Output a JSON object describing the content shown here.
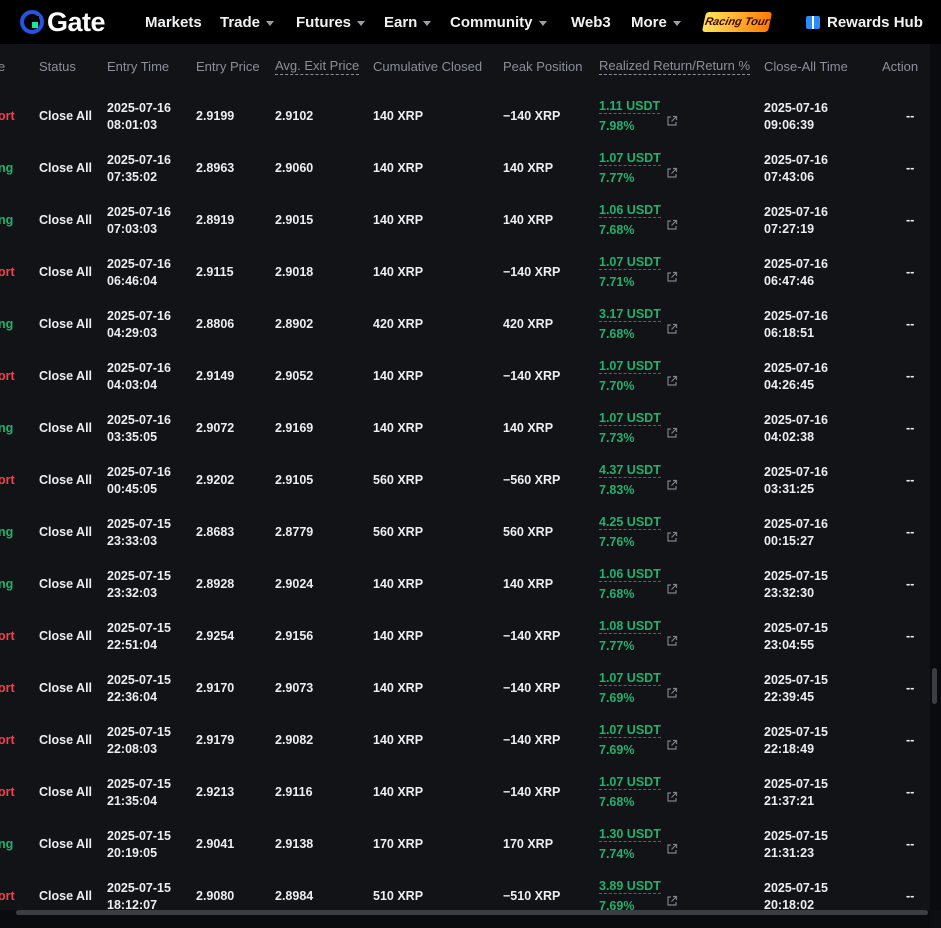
{
  "nav": {
    "logo": "Gate",
    "items": [
      {
        "label": "Markets",
        "caret": false
      },
      {
        "label": "Trade",
        "caret": true
      },
      {
        "label": "Futures",
        "caret": true
      },
      {
        "label": "Earn",
        "caret": true
      },
      {
        "label": "Community",
        "caret": true
      },
      {
        "label": "Web3",
        "caret": false
      },
      {
        "label": "More",
        "caret": true
      }
    ],
    "racing_badge": "Racing Tour",
    "rewards_hub": "Rewards Hub"
  },
  "table": {
    "headers": {
      "side": "e",
      "status": "Status",
      "entry_time": "Entry Time",
      "entry_price": "Entry Price",
      "avg_exit": "Avg. Exit Price",
      "cum_closed": "Cumulative Closed",
      "peak": "Peak Position",
      "realized": "Realized Return/Return %",
      "close_time": "Close-All Time",
      "action": "Action"
    },
    "rows": [
      {
        "side": "ort",
        "side_type": "short",
        "status": "Close All",
        "entry_date": "2025-07-16",
        "entry_clock": "08:01:03",
        "entry_price": "2.9199",
        "avg_exit": "2.9102",
        "cum": "140 XRP",
        "peak": "−140 XRP",
        "usdt": "1.11 USDT",
        "pct": "7.98%",
        "close_date": "2025-07-16",
        "close_clock": "09:06:39",
        "action": "--"
      },
      {
        "side": "ng",
        "side_type": "long",
        "status": "Close All",
        "entry_date": "2025-07-16",
        "entry_clock": "07:35:02",
        "entry_price": "2.8963",
        "avg_exit": "2.9060",
        "cum": "140 XRP",
        "peak": "140 XRP",
        "usdt": "1.07 USDT",
        "pct": "7.77%",
        "close_date": "2025-07-16",
        "close_clock": "07:43:06",
        "action": "--"
      },
      {
        "side": "ng",
        "side_type": "long",
        "status": "Close All",
        "entry_date": "2025-07-16",
        "entry_clock": "07:03:03",
        "entry_price": "2.8919",
        "avg_exit": "2.9015",
        "cum": "140 XRP",
        "peak": "140 XRP",
        "usdt": "1.06 USDT",
        "pct": "7.68%",
        "close_date": "2025-07-16",
        "close_clock": "07:27:19",
        "action": "--"
      },
      {
        "side": "ort",
        "side_type": "short",
        "status": "Close All",
        "entry_date": "2025-07-16",
        "entry_clock": "06:46:04",
        "entry_price": "2.9115",
        "avg_exit": "2.9018",
        "cum": "140 XRP",
        "peak": "−140 XRP",
        "usdt": "1.07 USDT",
        "pct": "7.71%",
        "close_date": "2025-07-16",
        "close_clock": "06:47:46",
        "action": "--"
      },
      {
        "side": "ng",
        "side_type": "long",
        "status": "Close All",
        "entry_date": "2025-07-16",
        "entry_clock": "04:29:03",
        "entry_price": "2.8806",
        "avg_exit": "2.8902",
        "cum": "420 XRP",
        "peak": "420 XRP",
        "usdt": "3.17 USDT",
        "pct": "7.68%",
        "close_date": "2025-07-16",
        "close_clock": "06:18:51",
        "action": "--"
      },
      {
        "side": "ort",
        "side_type": "short",
        "status": "Close All",
        "entry_date": "2025-07-16",
        "entry_clock": "04:03:04",
        "entry_price": "2.9149",
        "avg_exit": "2.9052",
        "cum": "140 XRP",
        "peak": "−140 XRP",
        "usdt": "1.07 USDT",
        "pct": "7.70%",
        "close_date": "2025-07-16",
        "close_clock": "04:26:45",
        "action": "--"
      },
      {
        "side": "ng",
        "side_type": "long",
        "status": "Close All",
        "entry_date": "2025-07-16",
        "entry_clock": "03:35:05",
        "entry_price": "2.9072",
        "avg_exit": "2.9169",
        "cum": "140 XRP",
        "peak": "140 XRP",
        "usdt": "1.07 USDT",
        "pct": "7.73%",
        "close_date": "2025-07-16",
        "close_clock": "04:02:38",
        "action": "--"
      },
      {
        "side": "ort",
        "side_type": "short",
        "status": "Close All",
        "entry_date": "2025-07-16",
        "entry_clock": "00:45:05",
        "entry_price": "2.9202",
        "avg_exit": "2.9105",
        "cum": "560 XRP",
        "peak": "−560 XRP",
        "usdt": "4.37 USDT",
        "pct": "7.83%",
        "close_date": "2025-07-16",
        "close_clock": "03:31:25",
        "action": "--"
      },
      {
        "side": "ng",
        "side_type": "long",
        "status": "Close All",
        "entry_date": "2025-07-15",
        "entry_clock": "23:33:03",
        "entry_price": "2.8683",
        "avg_exit": "2.8779",
        "cum": "560 XRP",
        "peak": "560 XRP",
        "usdt": "4.25 USDT",
        "pct": "7.76%",
        "close_date": "2025-07-16",
        "close_clock": "00:15:27",
        "action": "--"
      },
      {
        "side": "ng",
        "side_type": "long",
        "status": "Close All",
        "entry_date": "2025-07-15",
        "entry_clock": "23:32:03",
        "entry_price": "2.8928",
        "avg_exit": "2.9024",
        "cum": "140 XRP",
        "peak": "140 XRP",
        "usdt": "1.06 USDT",
        "pct": "7.68%",
        "close_date": "2025-07-15",
        "close_clock": "23:32:30",
        "action": "--"
      },
      {
        "side": "ort",
        "side_type": "short",
        "status": "Close All",
        "entry_date": "2025-07-15",
        "entry_clock": "22:51:04",
        "entry_price": "2.9254",
        "avg_exit": "2.9156",
        "cum": "140 XRP",
        "peak": "−140 XRP",
        "usdt": "1.08 USDT",
        "pct": "7.77%",
        "close_date": "2025-07-15",
        "close_clock": "23:04:55",
        "action": "--"
      },
      {
        "side": "ort",
        "side_type": "short",
        "status": "Close All",
        "entry_date": "2025-07-15",
        "entry_clock": "22:36:04",
        "entry_price": "2.9170",
        "avg_exit": "2.9073",
        "cum": "140 XRP",
        "peak": "−140 XRP",
        "usdt": "1.07 USDT",
        "pct": "7.69%",
        "close_date": "2025-07-15",
        "close_clock": "22:39:45",
        "action": "--"
      },
      {
        "side": "ort",
        "side_type": "short",
        "status": "Close All",
        "entry_date": "2025-07-15",
        "entry_clock": "22:08:03",
        "entry_price": "2.9179",
        "avg_exit": "2.9082",
        "cum": "140 XRP",
        "peak": "−140 XRP",
        "usdt": "1.07 USDT",
        "pct": "7.69%",
        "close_date": "2025-07-15",
        "close_clock": "22:18:49",
        "action": "--"
      },
      {
        "side": "ort",
        "side_type": "short",
        "status": "Close All",
        "entry_date": "2025-07-15",
        "entry_clock": "21:35:04",
        "entry_price": "2.9213",
        "avg_exit": "2.9116",
        "cum": "140 XRP",
        "peak": "−140 XRP",
        "usdt": "1.07 USDT",
        "pct": "7.68%",
        "close_date": "2025-07-15",
        "close_clock": "21:37:21",
        "action": "--"
      },
      {
        "side": "ng",
        "side_type": "long",
        "status": "Close All",
        "entry_date": "2025-07-15",
        "entry_clock": "20:19:05",
        "entry_price": "2.9041",
        "avg_exit": "2.9138",
        "cum": "170 XRP",
        "peak": "170 XRP",
        "usdt": "1.30 USDT",
        "pct": "7.74%",
        "close_date": "2025-07-15",
        "close_clock": "21:31:23",
        "action": "--"
      },
      {
        "side": "ort",
        "side_type": "short",
        "status": "Close All",
        "entry_date": "2025-07-15",
        "entry_clock": "18:12:07",
        "entry_price": "2.9080",
        "avg_exit": "2.8984",
        "cum": "510 XRP",
        "peak": "−510 XRP",
        "usdt": "3.89 USDT",
        "pct": "7.69%",
        "close_date": "2025-07-15",
        "close_clock": "20:18:02",
        "action": "--"
      }
    ]
  },
  "colors": {
    "profit": "#20b26c",
    "short": "#f0414d",
    "long": "#20b26c",
    "brand": "#2354e6"
  },
  "icons": {
    "logo": "gate-logo-icon",
    "share": "external-link-icon",
    "rewards": "gift-icon"
  }
}
